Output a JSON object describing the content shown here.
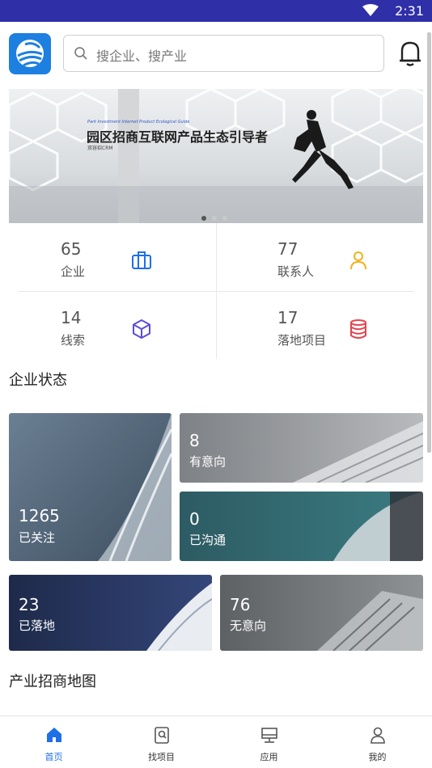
{
  "status_bar": {
    "time": "2:31"
  },
  "search": {
    "placeholder": "搜企业、搜产业"
  },
  "banner": {
    "title": "园区招商互联网产品生态引导者",
    "subtitle_en": "Park Investment Internet Product Ecological Guide",
    "subtitle": "双容招CRM"
  },
  "stats": [
    {
      "value": "65",
      "label": "企业",
      "icon": "briefcase-icon"
    },
    {
      "value": "77",
      "label": "联系人",
      "icon": "person-icon"
    },
    {
      "value": "14",
      "label": "线索",
      "icon": "cube-icon"
    },
    {
      "value": "17",
      "label": "落地项目",
      "icon": "database-icon"
    }
  ],
  "sections": {
    "company_status": "企业状态",
    "industry_map": "产业招商地图"
  },
  "status_cards": {
    "followed": {
      "value": "1265",
      "label": "已关注"
    },
    "intent": {
      "value": "8",
      "label": "有意向"
    },
    "contacted": {
      "value": "0",
      "label": "已沟通"
    },
    "landed": {
      "value": "23",
      "label": "已落地"
    },
    "no_intent": {
      "value": "76",
      "label": "无意向"
    }
  },
  "tabs": [
    {
      "label": "首页",
      "icon": "home-icon",
      "active": true
    },
    {
      "label": "找项目",
      "icon": "find-project-icon",
      "active": false
    },
    {
      "label": "应用",
      "icon": "apps-icon",
      "active": false
    },
    {
      "label": "我的",
      "icon": "profile-icon",
      "active": false
    }
  ],
  "colors": {
    "status_bar": "#2f2fa8",
    "accent": "#1e6fe8",
    "logo": "#1d7fe0"
  }
}
